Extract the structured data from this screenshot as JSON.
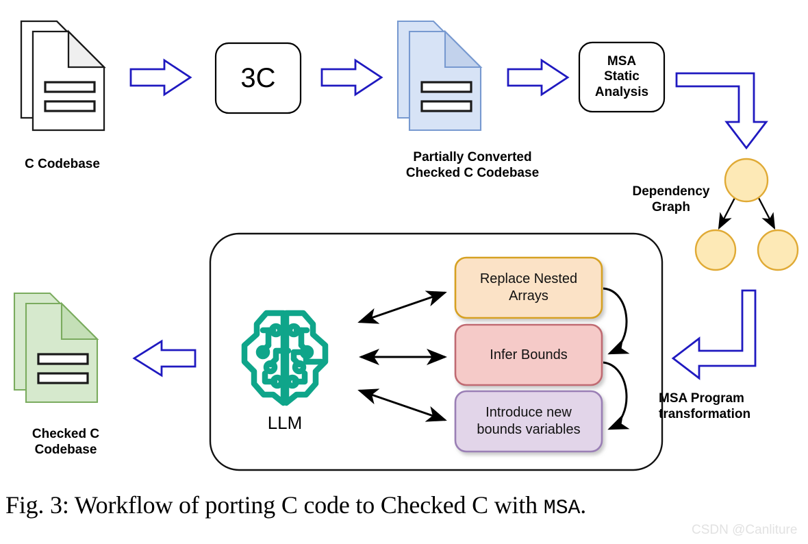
{
  "figure": {
    "caption_prefix": "Fig. 3: Workflow of porting C code to Checked C with ",
    "caption_mono": "MSA",
    "caption_suffix": ".",
    "watermark": "CSDN @Canliture"
  },
  "nodes": {
    "c_codebase_label": "C Codebase",
    "tool_3c_label": "3C",
    "partial_label": "Partially Converted\nChecked C Codebase",
    "msa_static_label": "MSA\nStatic\nAnalysis",
    "dependency_graph_label": "Dependency\nGraph",
    "msa_transform_label": "MSA Program\ntransformation",
    "llm_label": "LLM",
    "checked_c_label": "Checked C\nCodebase"
  },
  "tasks": [
    {
      "id": "replace-nested-arrays",
      "label": "Replace Nested\nArrays",
      "fill": "#fbe2c6",
      "stroke": "#d6a120"
    },
    {
      "id": "infer-bounds",
      "label": "Infer Bounds",
      "fill": "#f5cac8",
      "stroke": "#c06b72"
    },
    {
      "id": "introduce-bounds-variables",
      "label": "Introduce new\nbounds variables",
      "fill": "#e2d5e9",
      "stroke": "#9a7fb5"
    }
  ],
  "icons": {
    "c_codebase": "documents-icon",
    "partial_codebase": "documents-blue-icon",
    "checked_codebase": "documents-green-icon",
    "llm": "brain-circuit-icon",
    "dependency_graph": "tree-graph-icon"
  },
  "colors": {
    "arrow_blue": "#1f19c0",
    "doc_white_fill": "#ffffff",
    "doc_white_fold": "#efefef",
    "doc_blue_fill": "#d7e3f6",
    "doc_blue_fold": "#c2d2ec",
    "doc_blue_stroke": "#7799d0",
    "doc_green_fill": "#d6e9cd",
    "doc_green_fold": "#c4dfb7",
    "doc_green_stroke": "#7aab5e",
    "node_yellow_fill": "#fde9b6",
    "node_yellow_stroke": "#e0aa35",
    "brain_teal": "#0fa58a",
    "outline_black": "#000000"
  }
}
